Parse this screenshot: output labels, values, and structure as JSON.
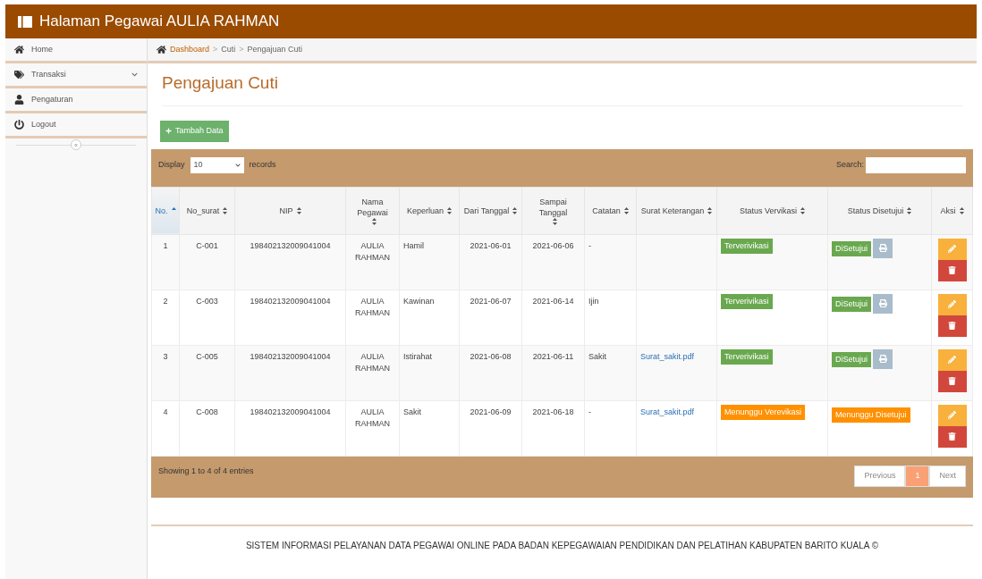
{
  "header": {
    "title": "Halaman Pegawai AULIA RAHMAN"
  },
  "sidebar": {
    "items": [
      {
        "label": "Home",
        "expandable": false
      },
      {
        "label": "Transaksi",
        "expandable": true
      },
      {
        "label": "Pengaturan",
        "expandable": false
      },
      {
        "label": "Logout",
        "expandable": false
      }
    ],
    "collapse_button": "«"
  },
  "breadcrumb": [
    {
      "label": "Dashboard",
      "kind": "link"
    },
    {
      "label": ">",
      "kind": "separator"
    },
    {
      "label": "Cuti",
      "kind": "item"
    },
    {
      "label": ">",
      "kind": "separator"
    },
    {
      "label": "Pengajuan Cuti",
      "kind": "item"
    }
  ],
  "page_title": "Pengajuan Cuti",
  "add_button": "Tambah Data",
  "table_controls": {
    "display_label": "Display",
    "page_size": "10",
    "records_label": "records",
    "search_label": "Search:"
  },
  "table": {
    "columns": [
      {
        "label": "No.",
        "sorted": true
      },
      {
        "label": "No_surat",
        "sorted": false
      },
      {
        "label": "NIP",
        "sorted": false
      },
      {
        "label": "Nama Pegawai",
        "sorted": false
      },
      {
        "label": "Keperluan",
        "sorted": false
      },
      {
        "label": "Dari Tanggal",
        "sorted": false
      },
      {
        "label": "Sampai Tanggal",
        "sorted": false
      },
      {
        "label": "Catatan",
        "sorted": false
      },
      {
        "label": "Surat Keterangan",
        "sorted": false
      },
      {
        "label": "Status Vervikasi",
        "sorted": false
      },
      {
        "label": "Status Disetujui",
        "sorted": false
      },
      {
        "label": "Aksi",
        "sorted": false
      }
    ],
    "rows": [
      {
        "no": "1",
        "no_surat": "C-001",
        "nip": "198402132009041004",
        "nama": "AULIA RAHMAN",
        "keperluan": "Hamil",
        "dari": "2021-06-01",
        "sampai": "2021-06-06",
        "catatan": "-",
        "surat": "",
        "verifikasi": {
          "text": "Terverivikasi",
          "kind": "done"
        },
        "disetujui": {
          "text": "DiSetujui",
          "kind": "done"
        },
        "print": true
      },
      {
        "no": "2",
        "no_surat": "C-003",
        "nip": "198402132009041004",
        "nama": "AULIA RAHMAN",
        "keperluan": "Kawinan",
        "dari": "2021-06-07",
        "sampai": "2021-06-14",
        "catatan": "Ijin",
        "surat": "",
        "verifikasi": {
          "text": "Terverivikasi",
          "kind": "done"
        },
        "disetujui": {
          "text": "DiSetujui",
          "kind": "done"
        },
        "print": true
      },
      {
        "no": "3",
        "no_surat": "C-005",
        "nip": "198402132009041004",
        "nama": "AULIA RAHMAN",
        "keperluan": "Istirahat",
        "dari": "2021-06-08",
        "sampai": "2021-06-11",
        "catatan": "Sakit",
        "surat": "Surat_sakit.pdf",
        "verifikasi": {
          "text": "Terverivikasi",
          "kind": "done"
        },
        "disetujui": {
          "text": "DiSetujui",
          "kind": "done"
        },
        "print": true
      },
      {
        "no": "4",
        "no_surat": "C-008",
        "nip": "198402132009041004",
        "nama": "AULIA RAHMAN",
        "keperluan": "Sakit",
        "dari": "2021-06-09",
        "sampai": "2021-06-18",
        "catatan": "-",
        "surat": "Surat_sakit.pdf",
        "verifikasi": {
          "text": "Menunggu Verevikasi",
          "kind": "waiting"
        },
        "disetujui": {
          "text": "Menunggu Disetujui",
          "kind": "waiting"
        },
        "print": false
      }
    ]
  },
  "table_info": "Showing 1 to 4 of 4 entries",
  "pagination": [
    {
      "label": "Previous",
      "selected": false
    },
    {
      "label": "1",
      "selected": true
    },
    {
      "label": "Next",
      "selected": false
    }
  ],
  "footer": "SISTEM INFORMASI PELAYANAN DATA PEGAWAI ONLINE PADA BADAN KEPEGAWAIAN PENDIDIKAN DAN PELATIHAN KABUPATEN BARITO KUALA ©"
}
